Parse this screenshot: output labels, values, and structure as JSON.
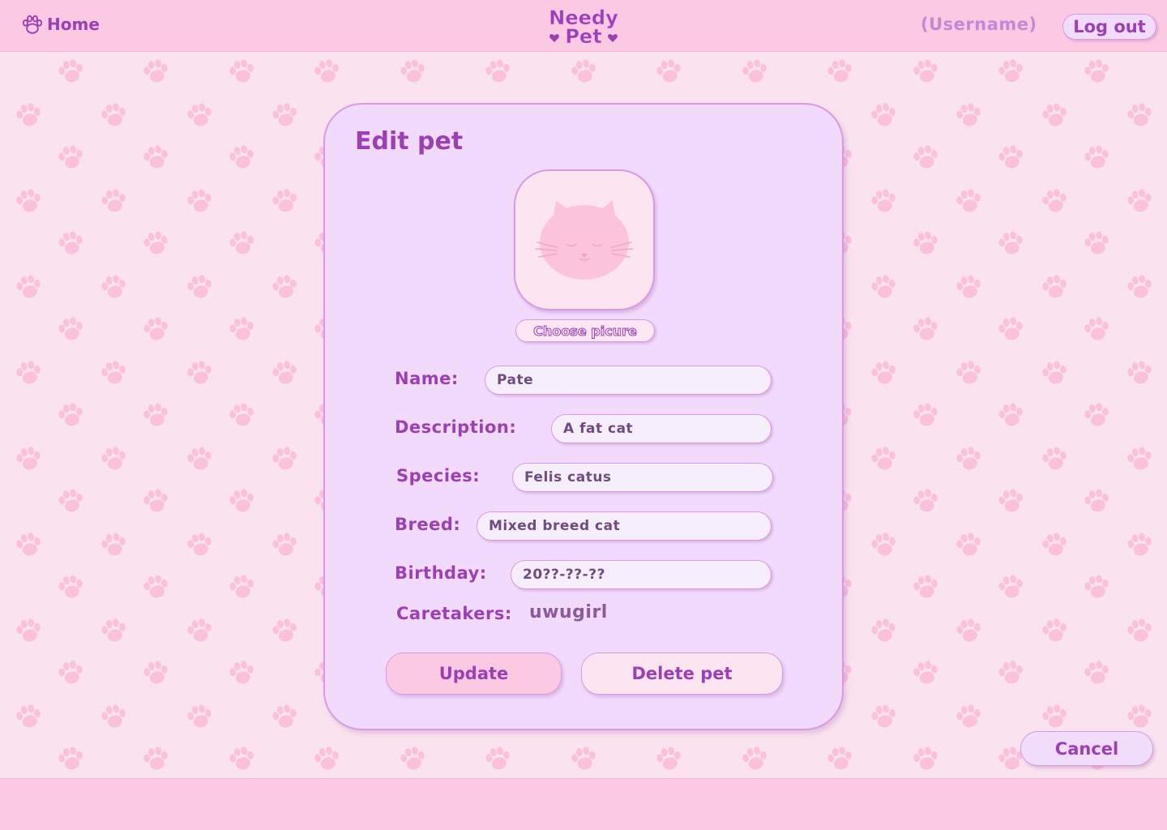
{
  "header": {
    "home_label": "Home",
    "logo_line1": "Needy",
    "logo_line2": "Pet",
    "username": "(Username)",
    "logout_label": "Log out"
  },
  "card": {
    "title": "Edit pet",
    "choose_picture_label": "Choose picure",
    "fields": {
      "name": {
        "label": "Name:",
        "value": "Pate"
      },
      "description": {
        "label": "Description:",
        "value": "A fat cat"
      },
      "species": {
        "label": "Species:",
        "value": "Felis catus"
      },
      "breed": {
        "label": "Breed:",
        "value": "Mixed breed cat"
      },
      "birthday": {
        "label": "Birthday:",
        "value": "20??-??-??"
      }
    },
    "caretakers": {
      "label": "Caretakers:",
      "value": "uwugirl"
    },
    "update_label": "Update",
    "delete_label": "Delete pet"
  },
  "cancel_label": "Cancel",
  "icons": {
    "home": "paw-icon",
    "avatar": "cat-face-icon",
    "background": "paw-print-pattern"
  },
  "colors": {
    "accent": "#9b3fb5",
    "header_bg": "#fcc9e3",
    "page_bg": "#fae3ee",
    "card_bg": "#f2dafd",
    "border": "#d79be6",
    "paw": "#fac0dc"
  }
}
